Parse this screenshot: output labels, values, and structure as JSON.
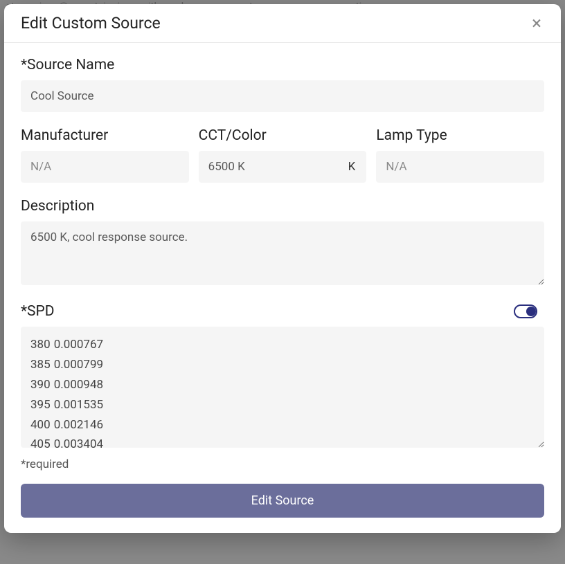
{
  "backdrop_text": "et.morrison@mountsinai.org with any bugs, comments, concerns, or suggestions.",
  "modal": {
    "title": "Edit Custom Source",
    "fields": {
      "source_name": {
        "label": "*Source Name",
        "value": "Cool Source"
      },
      "manufacturer": {
        "label": "Manufacturer",
        "placeholder": "N/A",
        "value": ""
      },
      "cct": {
        "label": "CCT/Color",
        "value": "6500 K",
        "suffix": "K"
      },
      "lamp_type": {
        "label": "Lamp Type",
        "placeholder": "N/A",
        "value": ""
      },
      "description": {
        "label": "Description",
        "value": "6500 K, cool response source."
      },
      "spd": {
        "label": "*SPD",
        "value": "380\t0.000767\n385\t0.000799\n390\t0.000948\n395\t0.001535\n400\t0.002146\n405\t0.003404"
      }
    },
    "required_note": "*required",
    "submit_label": "Edit Source"
  }
}
